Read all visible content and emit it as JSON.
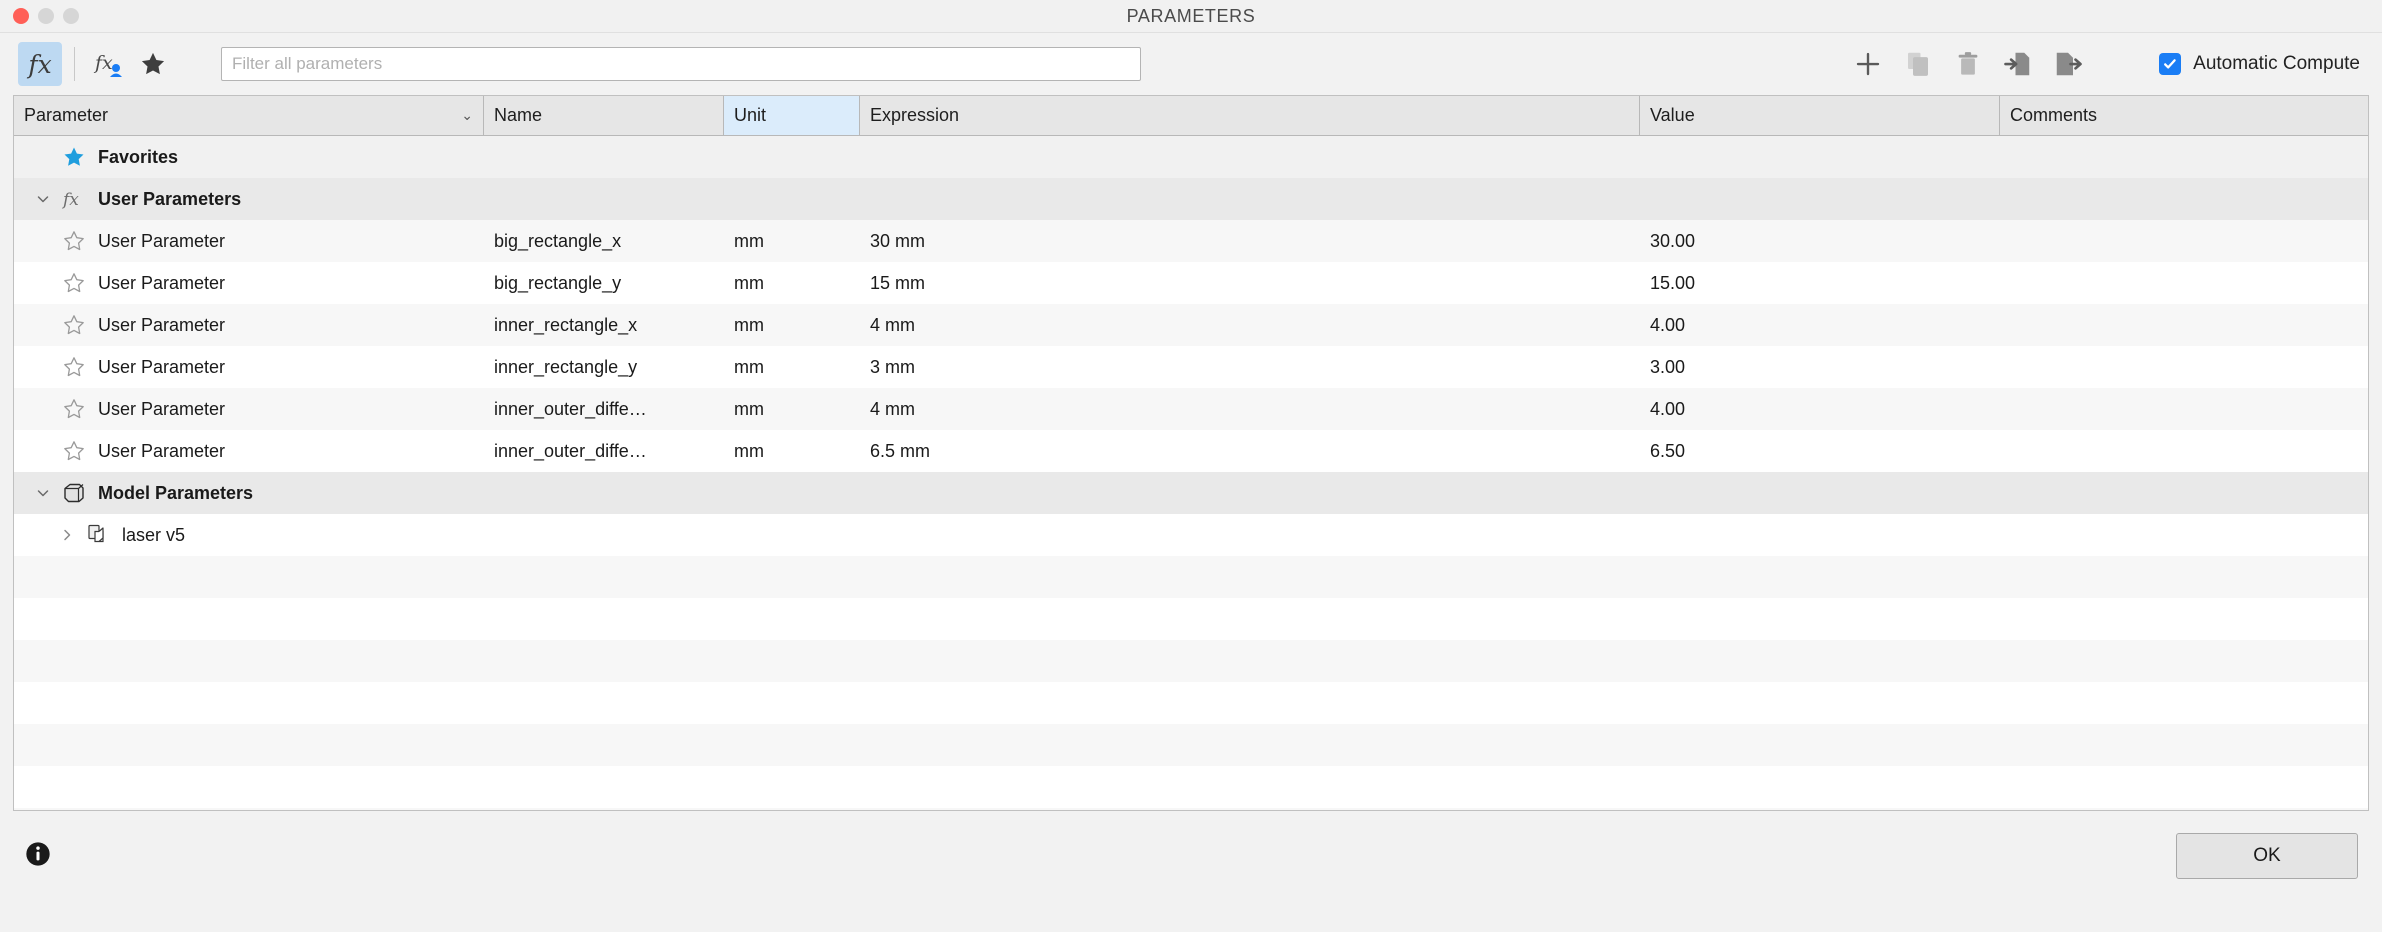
{
  "window": {
    "title": "PARAMETERS",
    "controls": [
      "close",
      "minimize",
      "zoom"
    ]
  },
  "toolbar": {
    "fx_button_label": "fx",
    "user_param_button_label": "fx",
    "favorite_button_label": "star",
    "filter": {
      "placeholder": "Filter all parameters",
      "value": ""
    },
    "actions": [
      {
        "name": "add-parameter",
        "icon": "plus-icon",
        "enabled": true
      },
      {
        "name": "copy-parameter",
        "icon": "copy-icon",
        "enabled": false
      },
      {
        "name": "delete-parameter",
        "icon": "trash-icon",
        "enabled": true
      },
      {
        "name": "import-parameters",
        "icon": "import-icon",
        "enabled": true
      },
      {
        "name": "export-parameters",
        "icon": "export-icon",
        "enabled": true
      }
    ],
    "automatic_compute": {
      "label": "Automatic Compute",
      "checked": true,
      "accent": "#1a7df5"
    }
  },
  "table": {
    "columns": [
      {
        "key": "parameter",
        "label": "Parameter",
        "sortable": true,
        "selected": false
      },
      {
        "key": "name",
        "label": "Name",
        "sortable": false,
        "selected": false
      },
      {
        "key": "unit",
        "label": "Unit",
        "sortable": false,
        "selected": true
      },
      {
        "key": "expression",
        "label": "Expression",
        "sortable": false,
        "selected": false
      },
      {
        "key": "value",
        "label": "Value",
        "sortable": false,
        "selected": false
      },
      {
        "key": "comments",
        "label": "Comments",
        "sortable": false,
        "selected": false
      }
    ],
    "selected_column_color": "#dbecfb",
    "rows": [
      {
        "kind": "group",
        "label": "Favorites",
        "icon": "star-filled-icon",
        "twisty": "none",
        "parameter": "",
        "name": "",
        "unit": "",
        "expression": "",
        "value": "",
        "comments": ""
      },
      {
        "kind": "group",
        "label": "User Parameters",
        "icon": "fx-icon",
        "twisty": "expanded",
        "parameter": "",
        "name": "",
        "unit": "",
        "expression": "",
        "value": "",
        "comments": ""
      },
      {
        "kind": "item",
        "icon": "star-outline-icon",
        "parameter": "User Parameter",
        "name": "big_rectangle_x",
        "unit": "mm",
        "expression": "30 mm",
        "value": "30.00",
        "comments": ""
      },
      {
        "kind": "item",
        "icon": "star-outline-icon",
        "parameter": "User Parameter",
        "name": "big_rectangle_y",
        "unit": "mm",
        "expression": "15 mm",
        "value": "15.00",
        "comments": ""
      },
      {
        "kind": "item",
        "icon": "star-outline-icon",
        "parameter": "User Parameter",
        "name": "inner_rectangle_x",
        "unit": "mm",
        "expression": "4 mm",
        "value": "4.00",
        "comments": ""
      },
      {
        "kind": "item",
        "icon": "star-outline-icon",
        "parameter": "User Parameter",
        "name": "inner_rectangle_y",
        "unit": "mm",
        "expression": "3 mm",
        "value": "3.00",
        "comments": ""
      },
      {
        "kind": "item",
        "icon": "star-outline-icon",
        "parameter": "User Parameter",
        "name": "inner_outer_diffe…",
        "unit": "mm",
        "expression": "4 mm",
        "value": "4.00",
        "comments": ""
      },
      {
        "kind": "item",
        "icon": "star-outline-icon",
        "parameter": "User Parameter",
        "name": "inner_outer_diffe…",
        "unit": "mm",
        "expression": "6.5 mm",
        "value": "6.50",
        "comments": ""
      },
      {
        "kind": "group",
        "label": "Model Parameters",
        "icon": "cube-icon",
        "twisty": "expanded",
        "parameter": "",
        "name": "",
        "unit": "",
        "expression": "",
        "value": "",
        "comments": ""
      },
      {
        "kind": "component",
        "label": "laser v5",
        "icon": "component-icon",
        "twisty": "collapsed",
        "parameter": "",
        "name": "",
        "unit": "",
        "expression": "",
        "value": "",
        "comments": ""
      }
    ],
    "empty_row_count": 8
  },
  "footer": {
    "info_icon": "info-icon",
    "ok_label": "OK"
  }
}
